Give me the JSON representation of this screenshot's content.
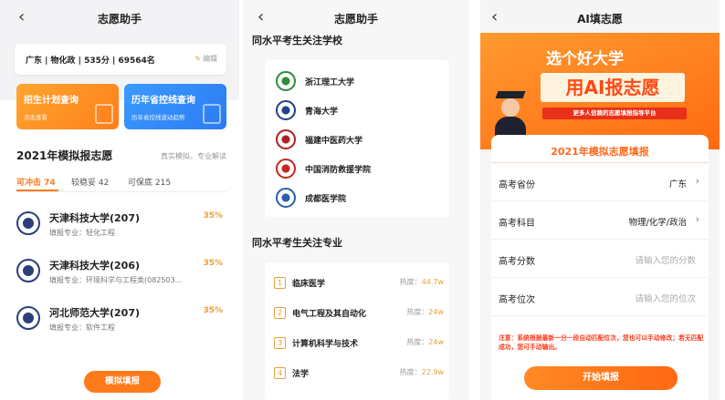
{
  "panel1": {
    "title": "志愿助手",
    "info": "广东  |  物化政  |  535分  |  69564名",
    "edit_label": "编辑",
    "quick_cards": [
      {
        "title": "招生计划查询",
        "subtitle": "点击查看"
      },
      {
        "title": "历年省控线查询",
        "subtitle": "历年省控线波动趋势"
      }
    ],
    "section_title": "2021年模拟报志愿",
    "section_subtitle": "真实模拟，专业解读",
    "tabs": [
      {
        "label": "可冲击 74"
      },
      {
        "label": "较稳妥 42"
      },
      {
        "label": "可保底 215"
      }
    ],
    "universities": [
      {
        "name": "天津科技大学(207)",
        "major": "填报专业：轻化工程",
        "probability": "35%"
      },
      {
        "name": "天津科技大学(206)",
        "major": "填报专业：环境科学与工程类(082503...",
        "probability": "35%"
      },
      {
        "name": "河北师范大学(207)",
        "major": "填报专业：软件工程",
        "probability": "35%"
      }
    ],
    "button_label": "模拟填报"
  },
  "panel2": {
    "title": "志愿助手",
    "schools_heading": "同水平考生关注学校",
    "schools": [
      {
        "name": "浙江理工大学",
        "color": "#2e8b3a"
      },
      {
        "name": "青海大学",
        "color": "#1f3f8f"
      },
      {
        "name": "福建中医药大学",
        "color": "#b01e1e"
      },
      {
        "name": "中国消防救援学院",
        "color": "#c4281c"
      },
      {
        "name": "成都医学院",
        "color": "#2a5db0"
      }
    ],
    "majors_heading": "同水平考生关注专业",
    "heat_label": "热度：",
    "majors": [
      {
        "num": "1",
        "name": "临床医学",
        "heat": "44.7w"
      },
      {
        "num": "2",
        "name": "电气工程及其自动化",
        "heat": "24w"
      },
      {
        "num": "3",
        "name": "计算机科学与技术",
        "heat": "24w"
      },
      {
        "num": "4",
        "name": "法学",
        "heat": "22.9w"
      }
    ]
  },
  "panel3": {
    "title": "AI填志愿",
    "banner_line1": "选个好大学",
    "banner_line2": "用AI报志愿",
    "banner_line3": "更多人信赖的志愿填报指导平台",
    "form_title": "2021年模拟志愿填报",
    "fields": [
      {
        "label": "高考省份",
        "value": "广东"
      },
      {
        "label": "高考科目",
        "value": "物理/化学/政治"
      },
      {
        "label": "高考分数",
        "placeholder": "请输入您的分数"
      },
      {
        "label": "高考位次",
        "placeholder": "请输入您的位次"
      }
    ],
    "note": "注意：系统根据最新一分一段自动匹配位次，您也可以手动修改；若无匹配成功，您可手动输出。",
    "button_label": "开始填报"
  }
}
